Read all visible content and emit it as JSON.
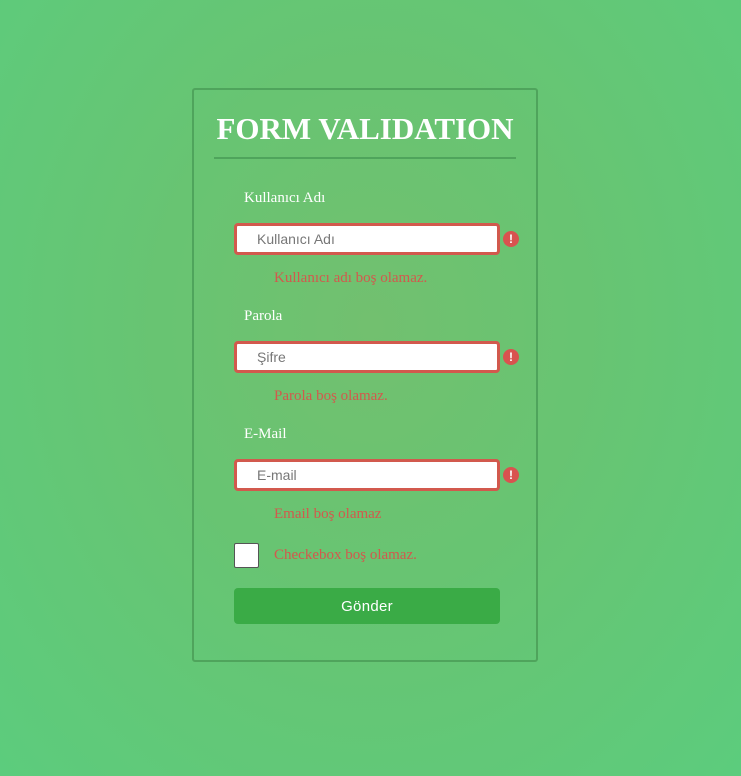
{
  "form": {
    "title": "FORM VALIDATION",
    "fields": [
      {
        "label": "Kullanıcı Adı",
        "placeholder": "Kullanıcı Adı",
        "value": "",
        "error_icon": "exclamation-circle-icon",
        "error": "Kullanıcı adı boş olamaz."
      },
      {
        "label": "Parola",
        "placeholder": "Şifre",
        "value": "",
        "error_icon": "exclamation-circle-icon",
        "error": "Parola boş olamaz."
      },
      {
        "label": "E-Mail",
        "placeholder": "E-mail",
        "value": "",
        "error_icon": "exclamation-circle-icon",
        "error": "Email boş olamaz"
      }
    ],
    "checkbox": {
      "checked": false,
      "error": "Checkebox boş olamaz."
    },
    "submit_label": "Gönder",
    "error_icon_glyph": "!"
  },
  "colors": {
    "background": "#5ccc7d",
    "card_border": "#4fa45c",
    "error": "#d2594d",
    "error_icon": "#d9534f",
    "button": "#3aab46",
    "text": "#ffffff"
  }
}
